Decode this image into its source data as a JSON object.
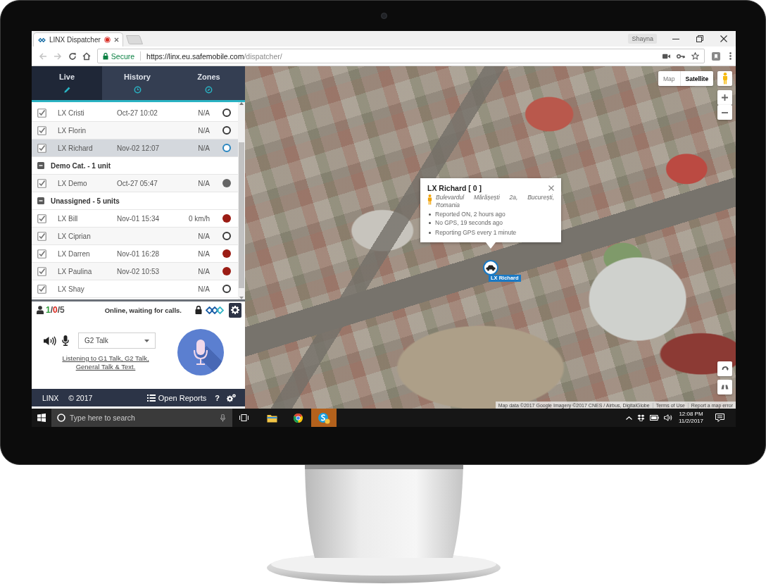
{
  "browser": {
    "tabs": [
      {
        "title": "LINX Dispatcher",
        "recording": true,
        "selected": true
      }
    ],
    "profile": "Shayna",
    "nav_buttons": [
      {
        "disabled": true
      },
      {
        "disabled": true
      }
    ],
    "address_bar": {
      "security": "Secure",
      "url_host": "https://linx.eu.safemobile.com",
      "url_path": "/dispatcher/"
    }
  },
  "sidebar": {
    "tabs": [
      {
        "label": "Live",
        "selected": true
      },
      {
        "label": "History",
        "selected": false
      },
      {
        "label": "Zones",
        "selected": false
      }
    ],
    "groups": [
      {
        "units": [
          {
            "name": "LX Cristi",
            "time": "Oct-27 10:02",
            "speed": "N/A",
            "checked": true,
            "selected": false,
            "color": "#3a3a3a",
            "filled": false
          },
          {
            "name": "LX Florin",
            "speed": "N/A",
            "checked": true,
            "selected": false,
            "color": "#3a3a3a",
            "filled": false
          },
          {
            "name": "LX Richard",
            "time": "Nov-02 12:07",
            "speed": "N/A",
            "checked": true,
            "selected": true,
            "color": "#2a86c0",
            "filled": false
          }
        ]
      },
      {
        "label": "Demo Cat. - 1 unit",
        "expanded": true,
        "units": [
          {
            "name": "LX Demo",
            "time": "Oct-27 05:47",
            "speed": "N/A",
            "checked": true,
            "selected": false,
            "color": "#666666",
            "filled": true
          }
        ]
      },
      {
        "label": "Unassigned - 5 units",
        "expanded": true,
        "units": [
          {
            "name": "LX Bill",
            "time": "Nov-01 15:34",
            "speed": "0 km/h",
            "checked": true,
            "selected": false,
            "color": "#9b1c14",
            "filled": true
          },
          {
            "name": "LX Ciprian",
            "speed": "N/A",
            "checked": true,
            "selected": false,
            "color": "#3a3a3a",
            "filled": false
          },
          {
            "name": "LX Darren",
            "time": "Nov-01 16:28",
            "speed": "N/A",
            "checked": true,
            "selected": false,
            "color": "#9b1c14",
            "filled": true
          },
          {
            "name": "LX Paulina",
            "time": "Nov-02 10:53",
            "speed": "N/A",
            "checked": true,
            "selected": false,
            "color": "#9b1c14",
            "filled": true
          },
          {
            "name": "LX Shay",
            "speed": "N/A",
            "checked": true,
            "selected": false,
            "color": "#3a3a3a",
            "filled": false
          }
        ]
      }
    ],
    "status": {
      "counts": [
        {
          "value": "1",
          "color": "#2e9b3a"
        },
        {
          "value": "0",
          "color": "#d9261c"
        },
        {
          "value": "5",
          "color": "#555555"
        }
      ],
      "separator": "/",
      "message": "Online, waiting for calls."
    },
    "talk": {
      "channel": "G2 Talk",
      "listening": "Listening to G1 Talk, G2 Talk, General Talk & Text."
    },
    "footer": {
      "brand": "LINX",
      "copyright": "© 2017",
      "reports": "Open Reports",
      "help": "?"
    }
  },
  "map": {
    "type_toggle": [
      {
        "label": "Map",
        "selected": false
      },
      {
        "label": "Satellite",
        "selected": true
      }
    ],
    "popup": {
      "title": "LX Richard [ 0 ]",
      "address": "Bulevardul Mărășești 2a, București, Romania",
      "details": [
        "Reported ON, 2 hours ago",
        "No GPS, 19 seconds ago",
        "Reporting GPS every 1 minute"
      ]
    },
    "marker": {
      "label": "LX Richard"
    },
    "credits": {
      "attribution": "Map data ©2017 Google Imagery ©2017 CNES / Airbus, DigitalGlobe",
      "terms": "Terms of Use",
      "report": "Report a map error"
    }
  },
  "taskbar": {
    "search_placeholder": "Type here to search",
    "apps": [
      {
        "highlighted": false
      },
      {
        "highlighted": false
      },
      {
        "highlighted": true
      }
    ],
    "time": "12:08 PM",
    "date": "11/2/2017"
  }
}
